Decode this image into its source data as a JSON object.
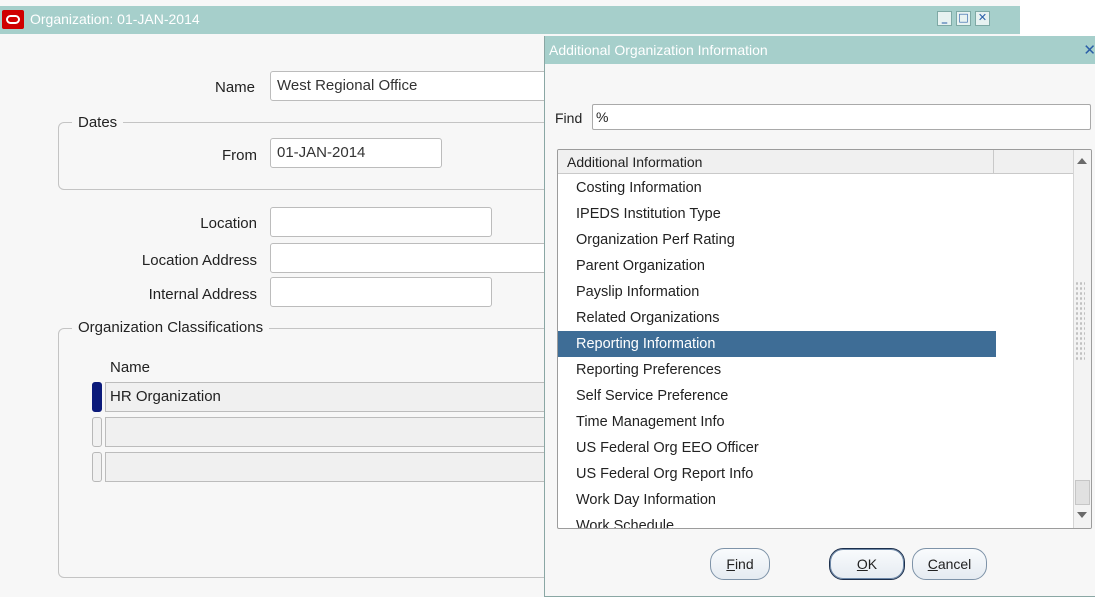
{
  "main_window": {
    "title": "Organization: 01-JAN-2014",
    "name_label": "Name",
    "name_value": "West Regional Office",
    "dates_group": "Dates",
    "from_label": "From",
    "from_value": "01-JAN-2014",
    "location_label": "Location",
    "location_value": "",
    "location_address_label": "Location Address",
    "location_address_value": "",
    "internal_address_label": "Internal Address",
    "internal_address_value": "",
    "classifications_group": "Organization Classifications",
    "classifications_name_header": "Name",
    "classifications": [
      "HR Organization",
      "",
      ""
    ]
  },
  "dialog": {
    "title": "Additional Organization Information",
    "find_label": "Find",
    "find_value": "%",
    "list_header": "Additional Information",
    "items": [
      "Costing Information",
      "IPEDS Institution Type",
      "Organization Perf Rating",
      "Parent Organization",
      "Payslip Information",
      "Related Organizations",
      "Reporting Information",
      "Reporting Preferences",
      "Self Service Preference",
      "Time Management Info",
      "US Federal Org EEO Officer",
      "US Federal Org Report Info",
      "Work Day Information",
      "Work Schedule"
    ],
    "selected_item": "Reporting Information",
    "find_button": {
      "mnemonic": "F",
      "rest": "ind"
    },
    "ok_button": {
      "mnemonic": "O",
      "rest": "K"
    },
    "cancel_button": {
      "mnemonic": "C",
      "rest": "ancel"
    }
  },
  "colors": {
    "titlebar": "#a6cfcb",
    "selection": "#3e6d96",
    "logo": "#d00000"
  },
  "icons": [
    "oracle-logo-icon",
    "minimize-icon",
    "maximize-icon",
    "close-icon",
    "scroll-up-icon",
    "scroll-down-icon"
  ]
}
